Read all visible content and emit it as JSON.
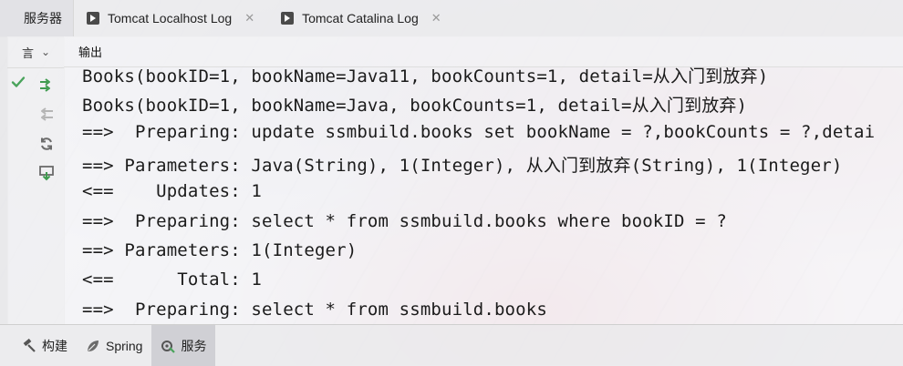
{
  "window": {
    "tabs": [
      {
        "label": "服务器",
        "icon": "none"
      },
      {
        "label": "Tomcat Localhost Log",
        "icon": "play-icon"
      },
      {
        "label": "Tomcat Catalina Log",
        "icon": "play-icon"
      }
    ],
    "close_glyph": "✕"
  },
  "toolbar": {
    "selector_label": "言",
    "selector_chevron": "⌄"
  },
  "console": {
    "header_label": "输出",
    "lines": [
      "Books(bookID=1, bookName=Java11, bookCounts=1, detail=从入门到放弃)",
      "Books(bookID=1, bookName=Java, bookCounts=1, detail=从入门到放弃)",
      "==>  Preparing: update ssmbuild.books set bookName = ?,bookCounts = ?,detai",
      "==> Parameters: Java(String), 1(Integer), 从入门到放弃(String), 1(Integer)",
      "<==    Updates: 1",
      "==>  Preparing: select * from ssmbuild.books where bookID = ?",
      "==> Parameters: 1(Integer)",
      "<==      Total: 1",
      "==>  Preparing: select * from ssmbuild.books"
    ]
  },
  "bottom_tabs": [
    {
      "label": "构建",
      "icon": "hammer-icon"
    },
    {
      "label": "Spring",
      "icon": "spring-leaf-icon"
    },
    {
      "label": "服务",
      "icon": "services-icon",
      "active": true
    }
  ],
  "colors": {
    "check_green": "#49a35b",
    "deploy_green": "#3f9b4f",
    "icon_gray": "#6b6b6b",
    "text": "#1b1b1b"
  }
}
